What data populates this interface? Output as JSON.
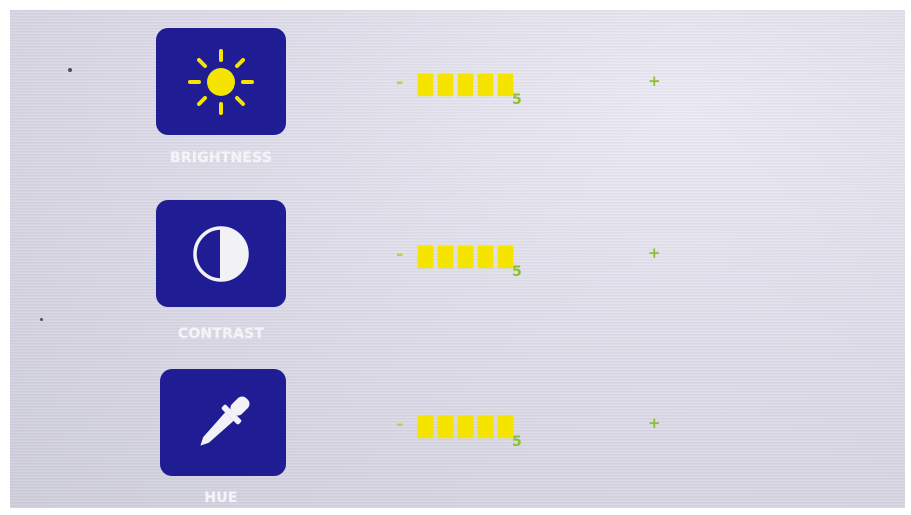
{
  "colors": {
    "tile": "#1f1c94",
    "label": "#f4f4f8",
    "bar": "#f4e400",
    "value": "#8dc030"
  },
  "settings": [
    {
      "label": "BRIGHTNESS",
      "icon": "sun-icon",
      "minus": "-",
      "plus": "+",
      "value": "5",
      "filled_segments": 5
    },
    {
      "label": "CONTRAST",
      "icon": "contrast-icon",
      "minus": "-",
      "plus": "+",
      "value": "5",
      "filled_segments": 5
    },
    {
      "label": "HUE",
      "icon": "eyedropper-icon",
      "minus": "-",
      "plus": "+",
      "value": "5",
      "filled_segments": 5
    }
  ]
}
